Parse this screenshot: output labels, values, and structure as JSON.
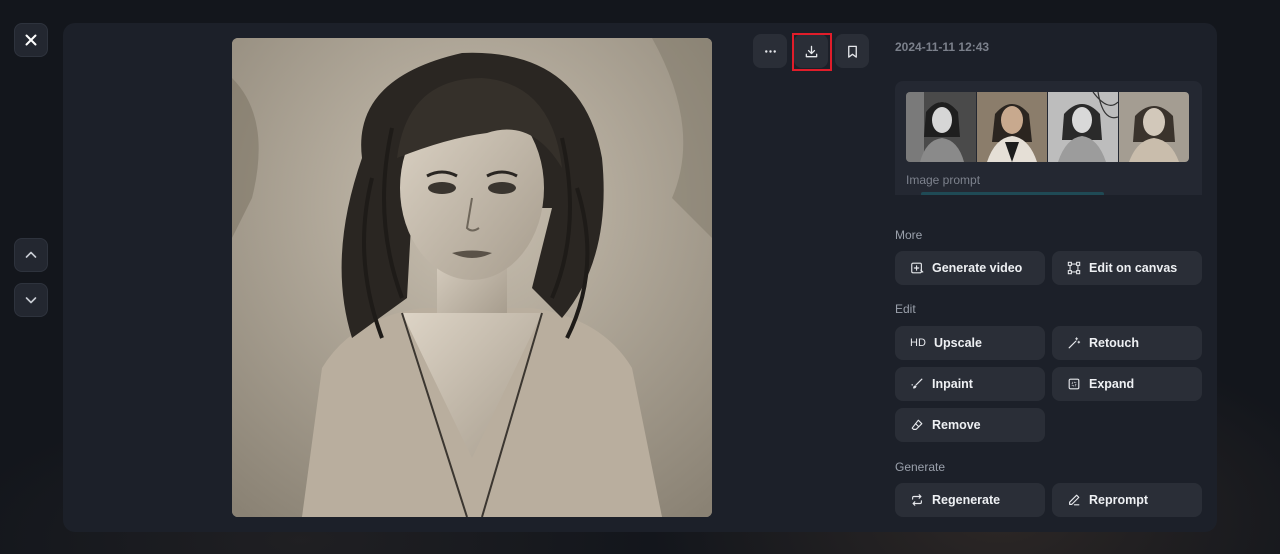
{
  "timestamp": "2024-11-11 12:43",
  "prompt_card": {
    "label": "Image prompt"
  },
  "sections": {
    "more": "More",
    "edit": "Edit",
    "generate": "Generate"
  },
  "actions": {
    "generate_video": "Generate video",
    "edit_on_canvas": "Edit on canvas",
    "upscale_badge": "HD",
    "upscale": "Upscale",
    "retouch": "Retouch",
    "inpaint": "Inpaint",
    "expand": "Expand",
    "remove": "Remove",
    "regenerate": "Regenerate",
    "reprompt": "Reprompt"
  },
  "icons": {
    "close": "close-icon",
    "up": "chevron-up-icon",
    "down": "chevron-down-icon",
    "more": "more-horizontal-icon",
    "download": "download-icon",
    "bookmark": "bookmark-icon"
  },
  "colors": {
    "highlight": "#e11d2a",
    "panel": "#1c2029",
    "button": "#2a2e37"
  }
}
